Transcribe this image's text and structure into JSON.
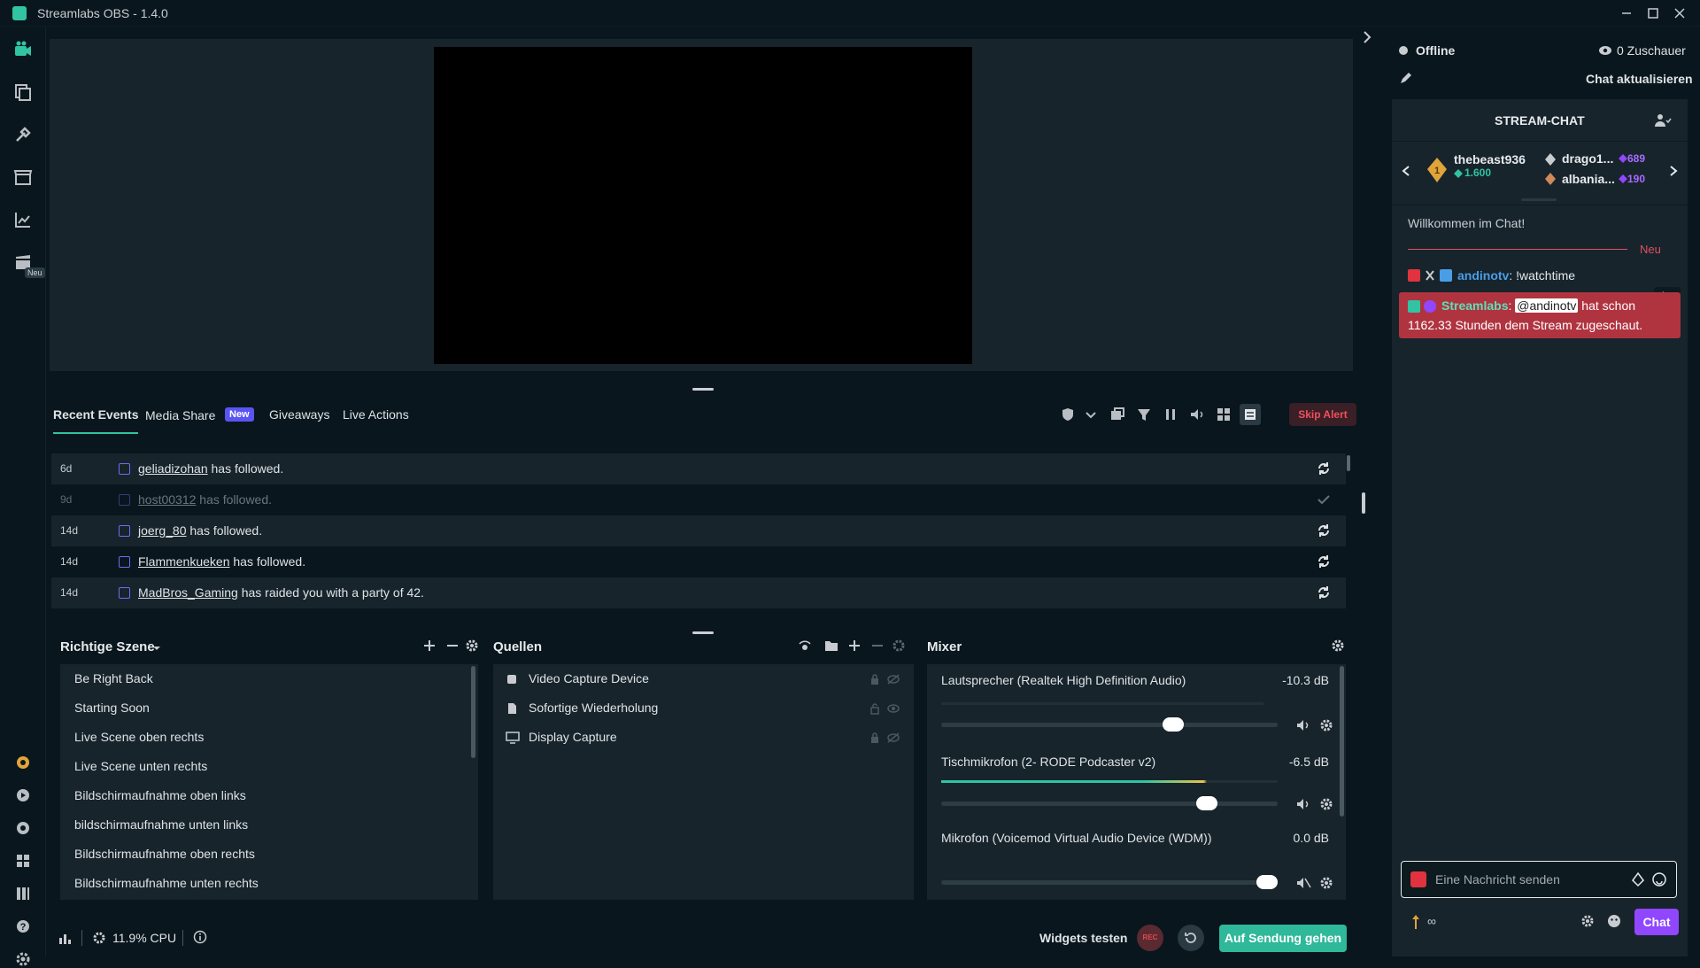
{
  "window": {
    "title": "Streamlabs OBS - 1.4.0"
  },
  "nav": {
    "neu_badge": "Neu"
  },
  "events": {
    "tabs": [
      {
        "label": "Recent Events"
      },
      {
        "label": "Media Share"
      },
      {
        "label": "Giveaways"
      },
      {
        "label": "Live Actions"
      }
    ],
    "media_share_badge": "New",
    "skip_alert": "Skip Alert",
    "rows": [
      {
        "time": "6d",
        "user": "geliadizohan",
        "text": " has followed."
      },
      {
        "time": "9d",
        "user": "host00312",
        "text": " has followed."
      },
      {
        "time": "14d",
        "user": "joerg_80",
        "text": " has followed."
      },
      {
        "time": "14d",
        "user": "Flammenkueken",
        "text": " has followed."
      },
      {
        "time": "14d",
        "user": "MadBros_Gaming",
        "text": " has raided you with a party of 42."
      }
    ]
  },
  "scenes": {
    "title": "Richtige Szene",
    "items": [
      "Be Right Back",
      "Starting Soon",
      "Live Scene oben rechts",
      "Live Scene unten rechts",
      "Bildschirmaufnahme oben links",
      "bildschirmaufnahme unten links",
      "Bildschirmaufnahme oben rechts",
      "Bildschirmaufnahme unten rechts"
    ]
  },
  "sources": {
    "title": "Quellen",
    "items": [
      "Video Capture Device",
      "Sofortige Wiederholung",
      "Display Capture"
    ]
  },
  "mixer": {
    "title": "Mixer",
    "channels": [
      {
        "name": "Lautsprecher (Realtek High Definition Audio)",
        "db": "-10.3 dB",
        "level": 0.72
      },
      {
        "name": "Tischmikrofon (2- RODE Podcaster v2)",
        "db": "-6.5 dB",
        "level": 0.82
      },
      {
        "name": "Mikrofon (Voicemod Virtual Audio Device (WDM))",
        "db": "0.0 dB",
        "level": 1.0
      }
    ]
  },
  "status": {
    "cpu": "11.9% CPU",
    "widgets_test": "Widgets testen",
    "rec": "REC",
    "go_live": "Auf Sendung gehen"
  },
  "chat": {
    "status": "Offline",
    "viewers": "0 Zuschauer",
    "refresh": "Chat aktualisieren",
    "header": "STREAM-CHAT",
    "top_user": {
      "name": "thebeast936",
      "amount": "1.600"
    },
    "others": [
      {
        "name": "drago1...",
        "amount": "689"
      },
      {
        "name": "albania...",
        "amount": "190"
      }
    ],
    "welcome": "Willkommen im Chat!",
    "new_label": "Neu",
    "msg1": {
      "user": "andinotv",
      "text": "!watchtime"
    },
    "msg2": {
      "user": "Streamlabs",
      "mention": "@andinotv",
      "text": " hat schon",
      "text2": "1162.33 Stunden dem Stream zugeschaut."
    },
    "input_placeholder": "Eine Nachricht senden",
    "points": "∞",
    "chat_button": "Chat"
  }
}
